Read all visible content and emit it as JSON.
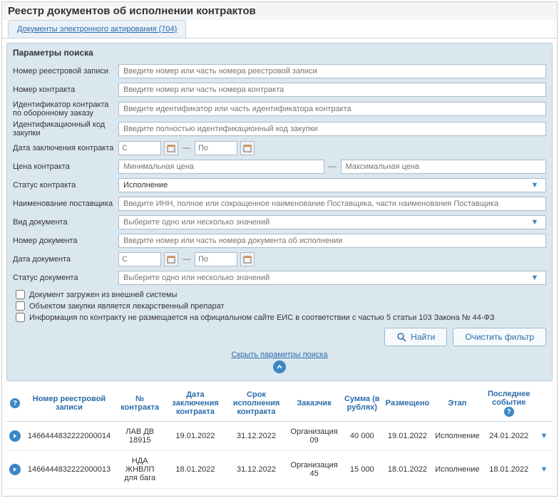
{
  "title": "Реестр документов об исполнении контрактов",
  "tab": "Документы электронного актирования (704)",
  "paramsTitle": "Параметры поиска",
  "labels": {
    "regNum": "Номер реестровой записи",
    "contractNum": "Номер контракта",
    "defId": "Идентификатор контракта по оборонному заказу",
    "ikz": "Идентификационный код закупки",
    "contractDate": "Дата заключения контракта",
    "price": "Цена контракта",
    "status": "Статус контракта",
    "supplier": "Наименование поставщика",
    "docType": "Вид документа",
    "docNum": "Номер документа",
    "docDate": "Дата документа",
    "docStatus": "Статус документа"
  },
  "placeholders": {
    "regNum": "Введите номер или часть номера реестровой записи",
    "contractNum": "Введите номер или часть номера контракта",
    "defId": "Введите идентификатор или часть идентификатора контракта",
    "ikz": "Введите полностью идентификационный код закупки",
    "dateFrom": "С",
    "dateTo": "По",
    "priceMin": "Минимальная цена",
    "priceMax": "Максимальная цена",
    "supplier": "Введите ИНН, полное или сокращенное наименование Поставщика, части наименования Поставщика",
    "select": "Выберите одно или несколько значений",
    "docNum": "Введите номер или часть номера документа об исполнении"
  },
  "statusValue": "Исполнение",
  "checks": {
    "c1": "Документ загружен из внешней системы",
    "c2": "Объектом закупки является лекарственный препарат",
    "c3": "Информация по контракту не размещается на официальном сайте ЕИС в соответствии с частью 5 статьи 103 Закона № 44-ФЗ"
  },
  "buttons": {
    "find": "Найти",
    "clear": "Очистить фильтр"
  },
  "collapse": "Скрыть параметры поиска",
  "columns": {
    "regNum": "Номер реестровой записи",
    "contractNum": "№ контракта",
    "contractDate": "Дата заключения контракта",
    "execPeriod": "Срок исполнения контракта",
    "customer": "Заказчик",
    "sum": "Сумма (в рублях)",
    "posted": "Размещено",
    "stage": "Этап",
    "lastEvent": "Последнее событие"
  },
  "rows": [
    {
      "reg": "1466444832222000014",
      "cn": "ЛАВ ДВ 18915",
      "cd": "19.01.2022",
      "ep": "31.12.2022",
      "cust": "Организация 09",
      "sum": "40 000",
      "post": "19.01.2022",
      "stage": "Исполнение",
      "le": "24.01.2022"
    },
    {
      "reg": "1466444832222000013",
      "cn": "НДА ЖНВЛП для бага",
      "cd": "18.01.2022",
      "ep": "31.12.2022",
      "cust": "Организация 45",
      "sum": "15 000",
      "post": "18.01.2022",
      "stage": "Исполнение",
      "le": "18.01.2022"
    }
  ]
}
